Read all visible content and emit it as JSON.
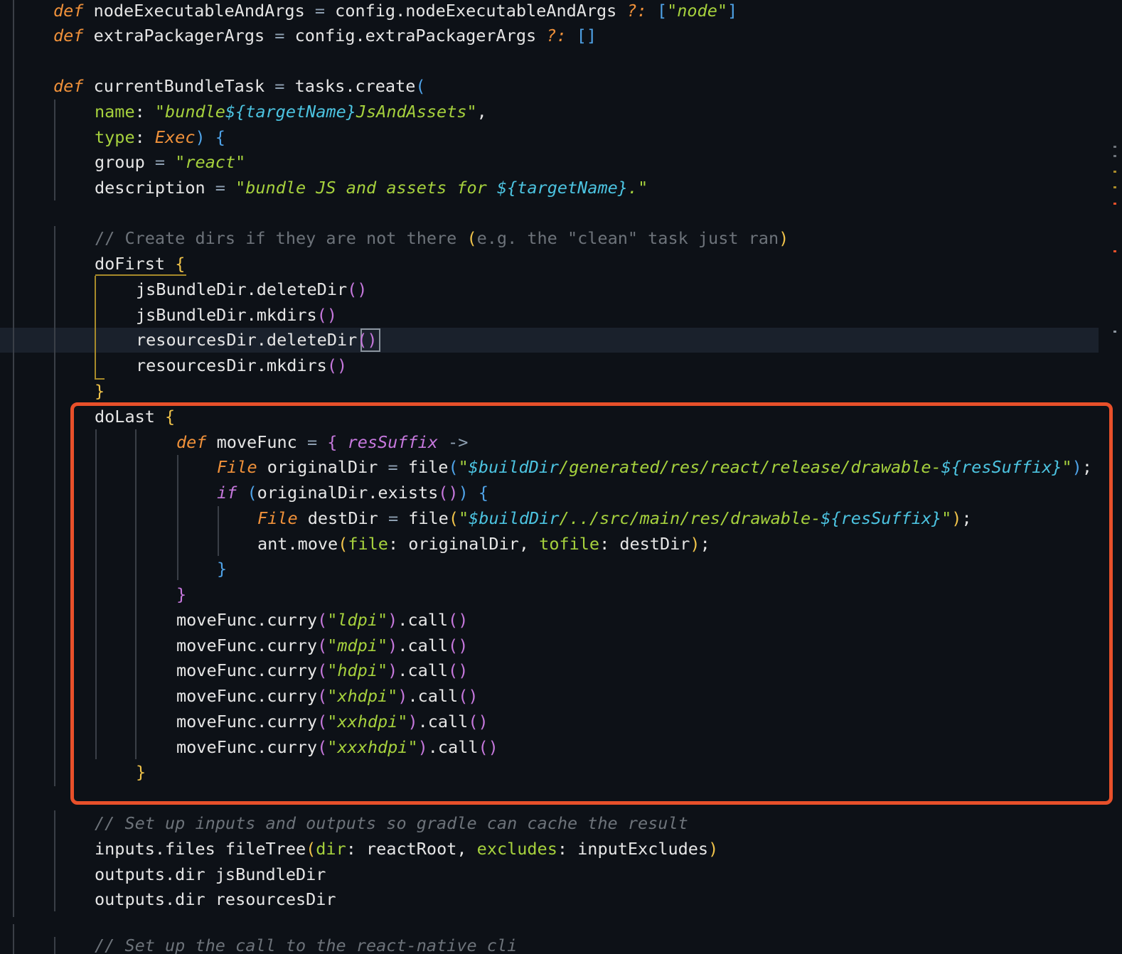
{
  "editor": {
    "language": "groovy",
    "theme_colors": {
      "background": "#0d1117",
      "keyword": "#f0913a",
      "string": "#a6d13d",
      "interpolation": "#4cc3e0",
      "comment": "#6d737a",
      "bracket_level_1": "#f0c34a",
      "bracket_level_2": "#c678dd",
      "bracket_level_3": "#4fa3e8",
      "highlight_border": "#e8502a"
    },
    "lines": [
      {
        "id": "l1",
        "tokens": [
          [
            "def",
            "kw"
          ],
          [
            " nodeExecutableAndArgs ",
            "id"
          ],
          [
            "=",
            "op"
          ],
          [
            " config.nodeExecutableAndArgs ",
            "id"
          ],
          [
            "?:",
            "kw"
          ],
          [
            " ",
            "id"
          ],
          [
            "[",
            "br3"
          ],
          [
            "\"",
            "q"
          ],
          [
            "node",
            "str"
          ],
          [
            "\"",
            "q"
          ],
          [
            "]",
            "br3"
          ]
        ]
      },
      {
        "id": "l2",
        "tokens": [
          [
            "def",
            "kw"
          ],
          [
            " extraPackagerArgs ",
            "id"
          ],
          [
            "=",
            "op"
          ],
          [
            " config.extraPackagerArgs ",
            "id"
          ],
          [
            "?:",
            "kw"
          ],
          [
            " ",
            "id"
          ],
          [
            "[]",
            "br3"
          ]
        ]
      },
      {
        "id": "l3",
        "tokens": [
          [
            "def",
            "kw"
          ],
          [
            " currentBundleTask ",
            "id"
          ],
          [
            "=",
            "op"
          ],
          [
            " tasks.create",
            "id"
          ],
          [
            "(",
            "br3"
          ]
        ]
      },
      {
        "id": "l4",
        "tokens": [
          [
            "name",
            "named"
          ],
          [
            ": ",
            "id"
          ],
          [
            "\"",
            "q"
          ],
          [
            "bundle",
            "str"
          ],
          [
            "${targetName}",
            "interp"
          ],
          [
            "JsAndAssets",
            "str"
          ],
          [
            "\"",
            "q"
          ],
          [
            ",",
            "id"
          ]
        ]
      },
      {
        "id": "l5",
        "tokens": [
          [
            "type",
            "named"
          ],
          [
            ": ",
            "id"
          ],
          [
            "Exec",
            "type"
          ],
          [
            ")",
            "br3"
          ],
          [
            " ",
            "id"
          ],
          [
            "{",
            "br3"
          ]
        ]
      },
      {
        "id": "l6",
        "tokens": [
          [
            "group ",
            "id"
          ],
          [
            "=",
            "op"
          ],
          [
            " ",
            "id"
          ],
          [
            "\"",
            "q"
          ],
          [
            "react",
            "str"
          ],
          [
            "\"",
            "q"
          ]
        ]
      },
      {
        "id": "l7",
        "tokens": [
          [
            "description ",
            "id"
          ],
          [
            "=",
            "op"
          ],
          [
            " ",
            "id"
          ],
          [
            "\"",
            "q"
          ],
          [
            "bundle JS and assets for ",
            "str"
          ],
          [
            "${targetName}",
            "interp"
          ],
          [
            ".",
            "str"
          ],
          [
            "\"",
            "q"
          ]
        ]
      },
      {
        "id": "l8",
        "tokens": [
          [
            "// Create dirs if they are not there ",
            "cmt"
          ],
          [
            "(",
            "br1"
          ],
          [
            "e.g. the \"clean\" task just ran",
            "cmt"
          ],
          [
            ")",
            "br1"
          ]
        ]
      },
      {
        "id": "l9",
        "tokens": [
          [
            "doFirst ",
            "id"
          ],
          [
            "{",
            "br1"
          ]
        ]
      },
      {
        "id": "l10",
        "tokens": [
          [
            "jsBundleDir.deleteDir",
            "id"
          ],
          [
            "()",
            "br2"
          ]
        ]
      },
      {
        "id": "l11",
        "tokens": [
          [
            "jsBundleDir.mkdirs",
            "id"
          ],
          [
            "()",
            "br2"
          ]
        ]
      },
      {
        "id": "l12",
        "tokens": [
          [
            "resourcesDir.deleteDir",
            "id"
          ],
          [
            "()",
            "br2"
          ]
        ]
      },
      {
        "id": "l13",
        "tokens": [
          [
            "resourcesDir.mkdirs",
            "id"
          ],
          [
            "()",
            "br2"
          ]
        ]
      },
      {
        "id": "l14",
        "tokens": [
          [
            "}",
            "br1"
          ]
        ]
      },
      {
        "id": "l15",
        "tokens": [
          [
            "doLast ",
            "id"
          ],
          [
            "{",
            "br1"
          ]
        ]
      },
      {
        "id": "l16",
        "tokens": [
          [
            "def",
            "kw"
          ],
          [
            " moveFunc ",
            "id"
          ],
          [
            "=",
            "op"
          ],
          [
            " ",
            "id"
          ],
          [
            "{",
            "br2"
          ],
          [
            " ",
            "id"
          ],
          [
            "resSuffix",
            "param"
          ],
          [
            " ->",
            "op"
          ]
        ]
      },
      {
        "id": "l17",
        "tokens": [
          [
            "File",
            "type"
          ],
          [
            " originalDir ",
            "id"
          ],
          [
            "=",
            "op"
          ],
          [
            " file",
            "id"
          ],
          [
            "(",
            "br3"
          ],
          [
            "\"",
            "q"
          ],
          [
            "$buildDir",
            "interp"
          ],
          [
            "/generated/res/react/release/drawable-",
            "str"
          ],
          [
            "${resSuffix}",
            "interp"
          ],
          [
            "\"",
            "q"
          ],
          [
            ")",
            "br3"
          ],
          [
            ";",
            "id"
          ]
        ]
      },
      {
        "id": "l18",
        "tokens": [
          [
            "if",
            "kw2"
          ],
          [
            " ",
            "id"
          ],
          [
            "(",
            "br3"
          ],
          [
            "originalDir.exists",
            "id"
          ],
          [
            "()",
            "br2"
          ],
          [
            ")",
            "br3"
          ],
          [
            " ",
            "id"
          ],
          [
            "{",
            "br3"
          ]
        ]
      },
      {
        "id": "l19",
        "tokens": [
          [
            "File",
            "type"
          ],
          [
            " destDir ",
            "id"
          ],
          [
            "=",
            "op"
          ],
          [
            " file",
            "id"
          ],
          [
            "(",
            "br1"
          ],
          [
            "\"",
            "q"
          ],
          [
            "$buildDir",
            "interp"
          ],
          [
            "/../src/main/res/drawable-",
            "str"
          ],
          [
            "${resSuffix}",
            "interp"
          ],
          [
            "\"",
            "q"
          ],
          [
            ")",
            "br1"
          ],
          [
            ";",
            "id"
          ]
        ]
      },
      {
        "id": "l20",
        "tokens": [
          [
            "ant.move",
            "id"
          ],
          [
            "(",
            "br1"
          ],
          [
            "file",
            "named"
          ],
          [
            ": originalDir, ",
            "id"
          ],
          [
            "tofile",
            "named"
          ],
          [
            ": destDir",
            "id"
          ],
          [
            ")",
            "br1"
          ],
          [
            ";",
            "id"
          ]
        ]
      },
      {
        "id": "l21",
        "tokens": [
          [
            "}",
            "br3"
          ]
        ]
      },
      {
        "id": "l22",
        "tokens": [
          [
            "}",
            "br2"
          ]
        ]
      },
      {
        "id": "l23",
        "tokens": [
          [
            "moveFunc.curry",
            "id"
          ],
          [
            "(",
            "br2"
          ],
          [
            "\"",
            "q"
          ],
          [
            "ldpi",
            "str"
          ],
          [
            "\"",
            "q"
          ],
          [
            ")",
            "br2"
          ],
          [
            ".call",
            "id"
          ],
          [
            "()",
            "br2"
          ]
        ]
      },
      {
        "id": "l24",
        "tokens": [
          [
            "moveFunc.curry",
            "id"
          ],
          [
            "(",
            "br2"
          ],
          [
            "\"",
            "q"
          ],
          [
            "mdpi",
            "str"
          ],
          [
            "\"",
            "q"
          ],
          [
            ")",
            "br2"
          ],
          [
            ".call",
            "id"
          ],
          [
            "()",
            "br2"
          ]
        ]
      },
      {
        "id": "l25",
        "tokens": [
          [
            "moveFunc.curry",
            "id"
          ],
          [
            "(",
            "br2"
          ],
          [
            "\"",
            "q"
          ],
          [
            "hdpi",
            "str"
          ],
          [
            "\"",
            "q"
          ],
          [
            ")",
            "br2"
          ],
          [
            ".call",
            "id"
          ],
          [
            "()",
            "br2"
          ]
        ]
      },
      {
        "id": "l26",
        "tokens": [
          [
            "moveFunc.curry",
            "id"
          ],
          [
            "(",
            "br2"
          ],
          [
            "\"",
            "q"
          ],
          [
            "xhdpi",
            "str"
          ],
          [
            "\"",
            "q"
          ],
          [
            ")",
            "br2"
          ],
          [
            ".call",
            "id"
          ],
          [
            "()",
            "br2"
          ]
        ]
      },
      {
        "id": "l27",
        "tokens": [
          [
            "moveFunc.curry",
            "id"
          ],
          [
            "(",
            "br2"
          ],
          [
            "\"",
            "q"
          ],
          [
            "xxhdpi",
            "str"
          ],
          [
            "\"",
            "q"
          ],
          [
            ")",
            "br2"
          ],
          [
            ".call",
            "id"
          ],
          [
            "()",
            "br2"
          ]
        ]
      },
      {
        "id": "l28",
        "tokens": [
          [
            "moveFunc.curry",
            "id"
          ],
          [
            "(",
            "br2"
          ],
          [
            "\"",
            "q"
          ],
          [
            "xxxhdpi",
            "str"
          ],
          [
            "\"",
            "q"
          ],
          [
            ")",
            "br2"
          ],
          [
            ".call",
            "id"
          ],
          [
            "()",
            "br2"
          ]
        ]
      },
      {
        "id": "l29",
        "tokens": [
          [
            "}",
            "br1"
          ]
        ]
      },
      {
        "id": "l30",
        "tokens": [
          [
            "// Set up inputs and outputs so gradle can cache the result",
            "cmt-it"
          ]
        ]
      },
      {
        "id": "l31",
        "tokens": [
          [
            "inputs.files fileTree",
            "id"
          ],
          [
            "(",
            "br1"
          ],
          [
            "dir",
            "named"
          ],
          [
            ": reactRoot, ",
            "id"
          ],
          [
            "excludes",
            "named"
          ],
          [
            ": inputExcludes",
            "id"
          ],
          [
            ")",
            "br1"
          ]
        ]
      },
      {
        "id": "l32",
        "tokens": [
          [
            "outputs.dir jsBundleDir",
            "id"
          ]
        ]
      },
      {
        "id": "l33",
        "tokens": [
          [
            "outputs.dir resourcesDir",
            "id"
          ]
        ]
      },
      {
        "id": "l34",
        "tokens": [
          [
            "// Set up the call to the react-native cli",
            "cmt-it"
          ]
        ]
      }
    ]
  }
}
